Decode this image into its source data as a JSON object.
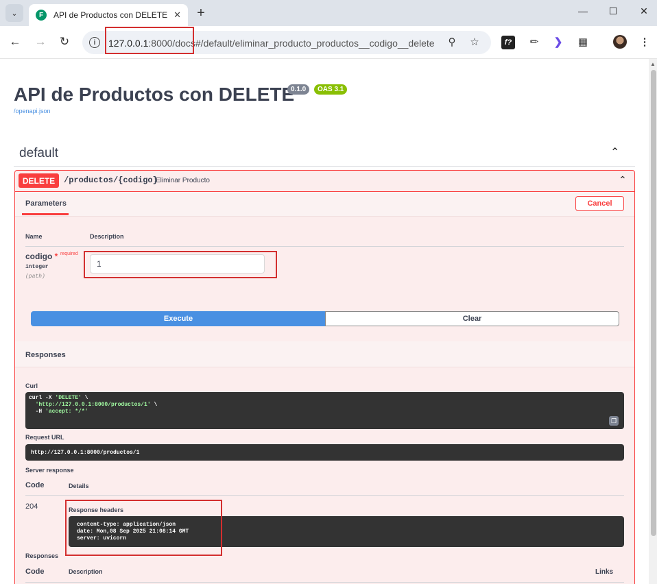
{
  "browser": {
    "tab_title": "API de Productos con DELETE -",
    "tab_favicon": "F",
    "url_host": "127.0.0.1",
    "url_rest": ":8000/docs#/default/eliminar_producto_productos__codigo__delete"
  },
  "api": {
    "title": "API de Productos con DELETE",
    "version_badge": "0.1.0",
    "oas_badge": "OAS 3.1",
    "openapi_link": "/openapi.json"
  },
  "tag": {
    "name": "default"
  },
  "operation": {
    "method": "DELETE",
    "path": "/productos/{codigo}",
    "summary": "Eliminar Producto",
    "tab_parameters": "Parameters",
    "cancel_label": "Cancel",
    "col_name": "Name",
    "col_description": "Description",
    "param": {
      "name": "codigo",
      "required_star": "*",
      "required_label": "required",
      "type": "integer",
      "location": "(path)",
      "value": "1"
    },
    "execute_label": "Execute",
    "clear_label": "Clear"
  },
  "responses": {
    "title": "Responses",
    "curl_label": "Curl",
    "curl_line1_a": "curl -X ",
    "curl_line1_b": "'DELETE'",
    "curl_line1_c": " \\",
    "curl_line2_a": "  ",
    "curl_line2_b": "'http://127.0.0.1:8000/productos/1'",
    "curl_line2_c": " \\",
    "curl_line3_a": "  -H ",
    "curl_line3_b": "'accept: */*'",
    "request_url_label": "Request URL",
    "request_url": "http://127.0.0.1:8000/productos/1",
    "server_response_label": "Server response",
    "col_code": "Code",
    "col_details": "Details",
    "code": "204",
    "headers_label": "Response headers",
    "headers_text": "content-type: application/json\ndate: Mon,08 Sep 2025 21:08:14 GMT\nserver: uvicorn",
    "responses2_label": "Responses",
    "col_code2": "Code",
    "col_description2": "Description",
    "col_links": "Links"
  }
}
